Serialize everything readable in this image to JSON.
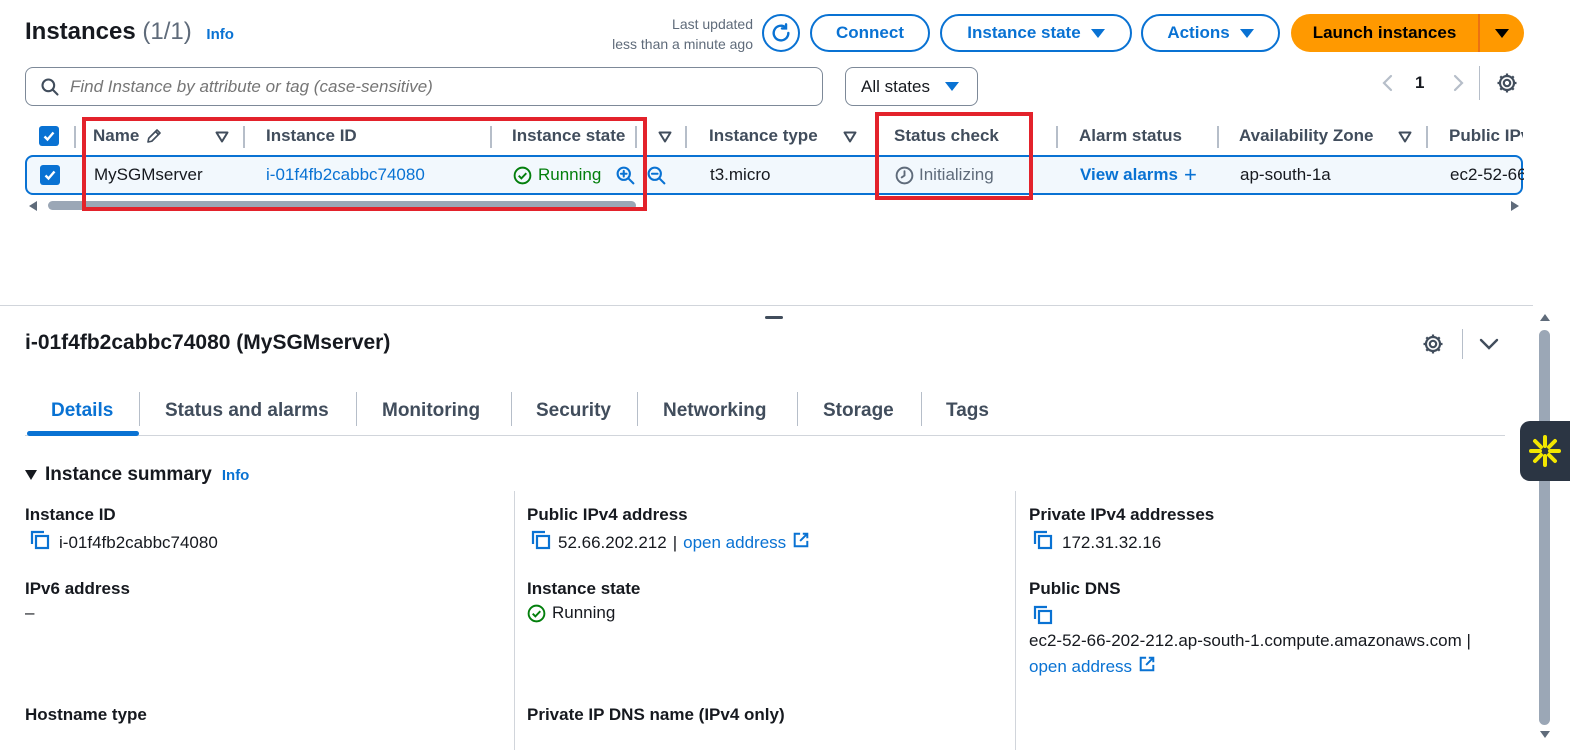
{
  "header": {
    "title": "Instances",
    "count": "(1/1)",
    "info": "Info",
    "last_updated_line1": "Last updated",
    "last_updated_line2": "less than a minute ago",
    "connect": "Connect",
    "instance_state": "Instance state",
    "actions": "Actions",
    "launch": "Launch instances"
  },
  "search": {
    "placeholder": "Find Instance by attribute or tag (case-sensitive)",
    "state_filter": "All states"
  },
  "pagination": {
    "page": "1"
  },
  "table": {
    "columns": [
      "Name",
      "Instance ID",
      "Instance state",
      "Instance type",
      "Status check",
      "Alarm status",
      "Availability Zone",
      "Public IPv"
    ],
    "row": {
      "name": "MySGMserver",
      "instance_id": "i-01f4fb2cabbc74080",
      "state": "Running",
      "type": "t3.micro",
      "status_check": "Initializing",
      "alarm": "View alarms",
      "alarm_plus": "+",
      "az": "ap-south-1a",
      "public_ip": "ec2-52-66"
    }
  },
  "detail": {
    "title": "i-01f4fb2cabbc74080 (MySGMserver)",
    "tabs": [
      "Details",
      "Status and alarms",
      "Monitoring",
      "Security",
      "Networking",
      "Storage",
      "Tags"
    ],
    "summary_title": "Instance summary",
    "summary_info": "Info",
    "fields": {
      "instance_id_label": "Instance ID",
      "instance_id_value": "i-01f4fb2cabbc74080",
      "public_ipv4_label": "Public IPv4 address",
      "public_ipv4_value": "52.66.202.212",
      "public_ipv4_sep": "|",
      "open_address": "open address",
      "private_ipv4_label": "Private IPv4 addresses",
      "private_ipv4_value": "172.31.32.16",
      "ipv6_label": "IPv6 address",
      "ipv6_value": "–",
      "instance_state_label": "Instance state",
      "instance_state_value": "Running",
      "public_dns_label": "Public DNS",
      "public_dns_value": "ec2-52-66-202-212.ap-south-1.compute.amazonaws.com |",
      "public_dns_open": "open address",
      "hostname_type_label": "Hostname type",
      "private_dns_label": "Private IP DNS name (IPv4 only)"
    }
  },
  "colors": {
    "link": "#0972d3",
    "primary": "#ff9900",
    "success": "#037f0c",
    "highlight": "#e3222b"
  },
  "icons": [
    "refresh-icon",
    "caret-down-icon",
    "search-icon",
    "chevron-left-icon",
    "chevron-right-icon",
    "gear-icon",
    "edit-icon",
    "zoom-in-icon",
    "zoom-out-icon",
    "check-circle-icon",
    "clock-icon",
    "copy-icon",
    "external-link-icon",
    "chevron-down-icon",
    "sparkle-icon"
  ]
}
